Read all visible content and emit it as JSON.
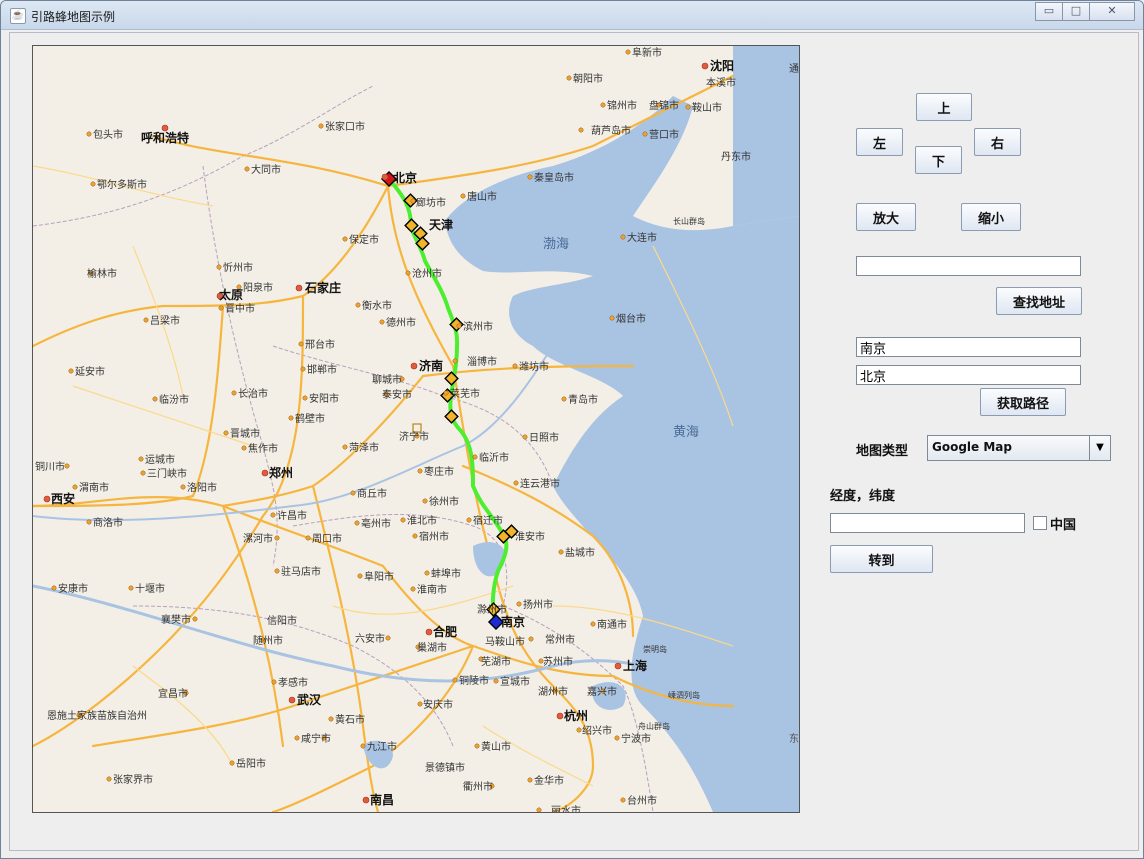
{
  "window": {
    "title": "引路蜂地图示例",
    "minimize": "▭",
    "maximize": "□",
    "close": "✕",
    "icon": "java-cup-icon"
  },
  "nav": {
    "up": "上",
    "left": "左",
    "down": "下",
    "right": "右",
    "zoom_in": "放大",
    "zoom_out": "缩小"
  },
  "search": {
    "address_value": "",
    "find_button": "查找地址"
  },
  "route": {
    "start_value": "南京",
    "end_value": "北京",
    "get_route_button": "获取路径"
  },
  "map_type": {
    "label": "地图类型",
    "selected": "Google Map"
  },
  "goto": {
    "label": "经度，纬度",
    "coord_value": "",
    "china_label": "中国",
    "china_checked": false,
    "button": "转到"
  },
  "map": {
    "cities": {
      "beijing": "北京",
      "tianjin": "天津",
      "shijiazhuang": "石家庄",
      "taiyuan": "太原",
      "jinan": "济南",
      "zhengzhou": "郑州",
      "xian": "西安",
      "wuhan": "武汉",
      "hefei": "合肥",
      "nanjing": "南京",
      "shanghai": "上海",
      "hangzhou": "杭州",
      "huhehaote": "呼和浩特",
      "shenyang": "沈阳",
      "nanchang": "南昌",
      "baotou": "包头市",
      "zhangjiakou": "张家口市",
      "datong": "大同市",
      "eerduosi": "鄂尔多斯市",
      "langfang": "廊坊市",
      "baoding": "保定市",
      "cangzhou": "沧州市",
      "tangshan": "唐山市",
      "qinhuangdao": "秦皇岛市",
      "chaoyang": "朝阳市",
      "fuxin": "阜新市",
      "jinzhou": "锦州市",
      "panjin": "盘锦市",
      "anshan": "鞍山市",
      "huludao": "葫芦岛市",
      "yingkou": "营口市",
      "dandong": "丹东市",
      "dalian": "大连市",
      "benxi": "本溪市",
      "xinzhou": "忻州市",
      "yangquan": "阳泉市",
      "jinzhong": "晋中市",
      "yulin": "榆林市",
      "lvliang": "吕梁市",
      "hengshui": "衡水市",
      "dezhou": "德州市",
      "binzhou": "滨州市",
      "zibo": "淄博市",
      "weifang": "潍坊市",
      "yantai": "烟台市",
      "qingdao": "青岛市",
      "rizhao": "日照市",
      "laiwu": "莱芜市",
      "taian": "泰安市",
      "liaocheng": "聊城市",
      "xingtai": "邢台市",
      "handan": "邯郸市",
      "changzhi": "长治市",
      "anyang": "安阳市",
      "hebi": "鹤壁市",
      "jincheng": "晋城市",
      "jiaozuo": "焦作市",
      "yuncheng": "运城市",
      "sanmenxia": "三门峡市",
      "weinan": "渭南市",
      "tongchuan": "铜川市",
      "yanan": "延安市",
      "linfen": "临汾市",
      "luoyang": "洛阳市",
      "jining": "济宁市",
      "heze": "菏泽市",
      "zaozhuang": "枣庄市",
      "linyi": "临沂市",
      "lianyungang": "连云港市",
      "shangqiu": "商丘市",
      "xuzhou": "徐州市",
      "xuchang": "许昌市",
      "bozhou": "亳州市",
      "huaibei": "淮北市",
      "suqian": "宿迁市",
      "huaian": "淮安市",
      "luohe": "漯河市",
      "zhoukou": "周口市",
      "suzhou_ah": "宿州市",
      "yancheng": "盐城市",
      "shangluo": "商洛市",
      "zhumadian": "驻马店市",
      "fuyang": "阜阳市",
      "bengbu": "蚌埠市",
      "huainan": "淮南市",
      "ankang": "安康市",
      "shiyan": "十堰市",
      "xiangyang": "襄樊市",
      "xinyang": "信阳市",
      "chuzhou": "滁州市",
      "yangzhou": "扬州市",
      "nantong": "南通市",
      "suizhou": "随州市",
      "luan": "六安市",
      "chaohu": "巢湖市",
      "maanshan": "马鞍山市",
      "changzhou": "常州市",
      "chongming": "崇明岛",
      "wuhu": "芜湖市",
      "suzhou": "苏州市",
      "yichang": "宜昌市",
      "xiaogan": "孝感市",
      "tongling": "铜陵市",
      "xuancheng": "宣城市",
      "huzhou": "湖州市",
      "jiaxing": "嘉兴市",
      "shengsi": "嵊泗列岛",
      "enshi": "恩施土家族苗族自治州",
      "anqing": "安庆市",
      "huangshi": "黄石市",
      "shaoxing": "绍兴市",
      "xianning": "咸宁市",
      "jiujiang": "九江市",
      "huangshan": "黄山市",
      "ningbo": "宁波市",
      "zhoushan": "舟山群岛",
      "yueyang": "岳阳市",
      "zhangjiajie": "张家界市",
      "jingdezhen": "景德镇市",
      "jinhua": "金华市",
      "quzhou": "衢州市",
      "lishui": "丽水市",
      "taizhou": "台州市",
      "tonghua": "通",
      "changshan": "长山群岛",
      "dong": "东",
      "bohai": "渤海",
      "huanghai": "黄海"
    }
  }
}
